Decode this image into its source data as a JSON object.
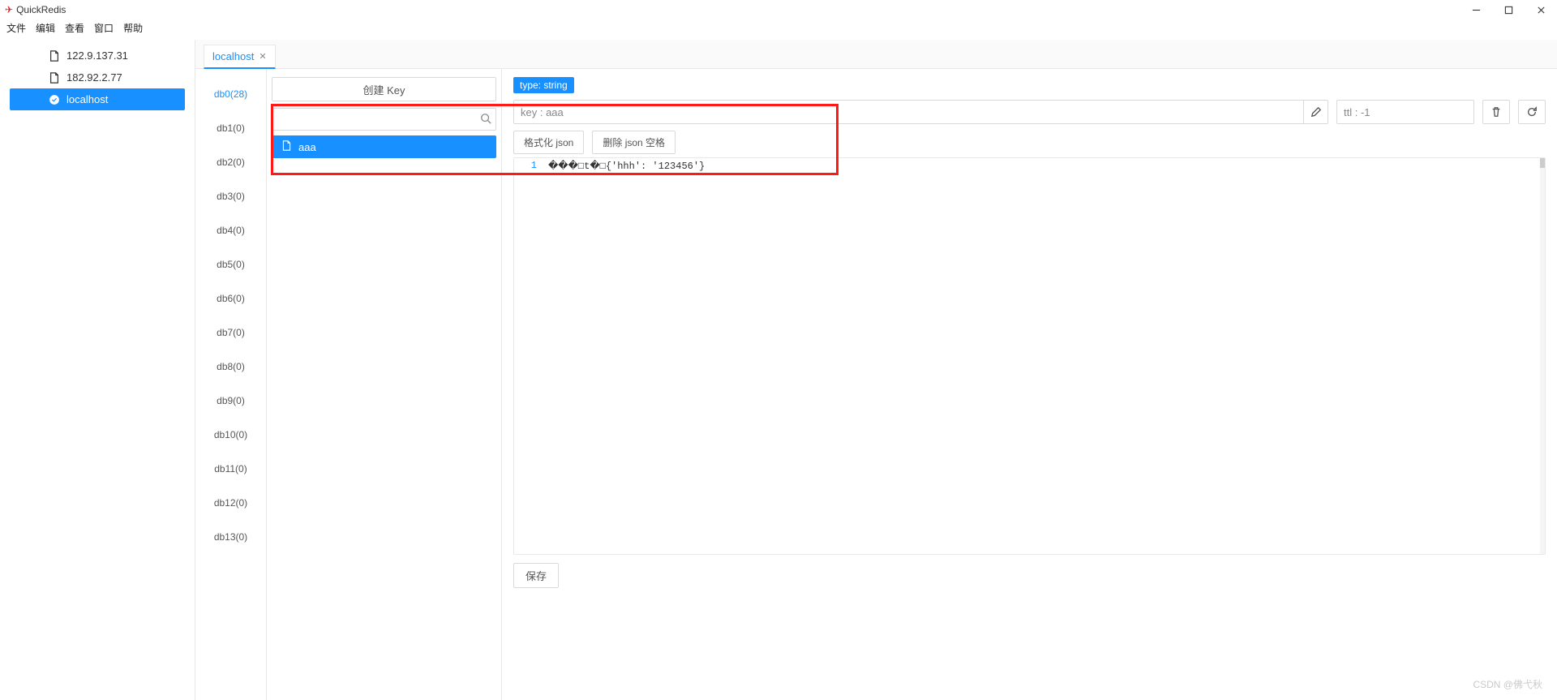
{
  "app": {
    "title": "QuickRedis"
  },
  "menubar": [
    "文件",
    "编辑",
    "查看",
    "窗口",
    "帮助"
  ],
  "connections": [
    {
      "label": "122.9.137.31",
      "active": false,
      "icon": "file"
    },
    {
      "label": "182.92.2.77",
      "active": false,
      "icon": "file"
    },
    {
      "label": "localhost",
      "active": true,
      "icon": "check"
    }
  ],
  "tabs": [
    {
      "label": "localhost",
      "active": true
    }
  ],
  "databases": [
    "db0(28)",
    "db1(0)",
    "db2(0)",
    "db3(0)",
    "db4(0)",
    "db5(0)",
    "db6(0)",
    "db7(0)",
    "db8(0)",
    "db9(0)",
    "db10(0)",
    "db11(0)",
    "db12(0)",
    "db13(0)"
  ],
  "active_db_index": 0,
  "key_column": {
    "create_label": "创建 Key",
    "search_value": "",
    "keys": [
      {
        "label": "aaa",
        "selected": true
      }
    ]
  },
  "detail": {
    "type_tag": "type: string",
    "key_value": "key : aaa",
    "ttl_value": "ttl : -1",
    "format_json_label": "格式化 json",
    "strip_json_label": "删除 json 空格",
    "editor_lines": [
      {
        "n": "1",
        "text": "���□t�□{'hhh': '123456'}"
      }
    ],
    "save_label": "保存"
  },
  "watermark": "CSDN @佛弋秋"
}
